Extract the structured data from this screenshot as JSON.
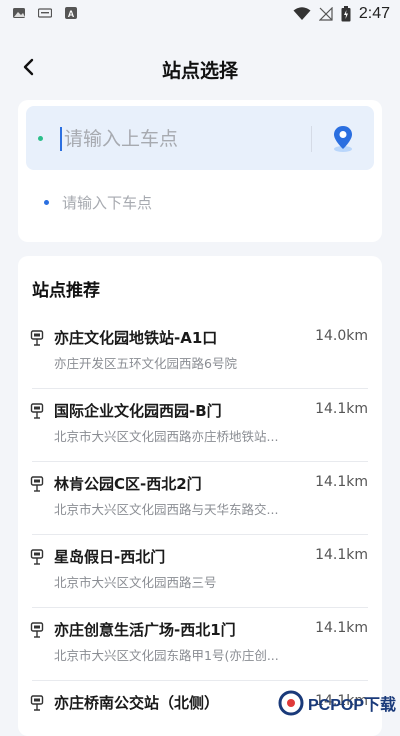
{
  "status_bar": {
    "time": "2:47",
    "icons": [
      "gallery-icon",
      "keyboard-icon",
      "font-icon",
      "wifi-icon",
      "no-signal-icon",
      "battery-charging-icon"
    ]
  },
  "header": {
    "title": "站点选择",
    "back_icon": "chevron-left-icon"
  },
  "route": {
    "pickup_placeholder": "请输入上车点",
    "dropoff_placeholder": "请输入下车点",
    "pickup_dot_color": "#2bbf8a",
    "dropoff_dot_color": "#2b6fe0",
    "locate_icon": "map-pin-icon"
  },
  "recommend": {
    "title": "站点推荐",
    "items": [
      {
        "name": "亦庄文化园地铁站-A1口",
        "distance": "14.0km",
        "address": "亦庄开发区五环文化园西路6号院"
      },
      {
        "name": "国际企业文化园西园-B门",
        "distance": "14.1km",
        "address": "北京市大兴区文化园西路亦庄桥地铁站..."
      },
      {
        "name": "林肯公园C区-西北2门",
        "distance": "14.1km",
        "address": "北京市大兴区文化园西路与天华东路交..."
      },
      {
        "name": "星岛假日-西北门",
        "distance": "14.1km",
        "address": "北京市大兴区文化园西路三号"
      },
      {
        "name": "亦庄创意生活广场-西北1门",
        "distance": "14.1km",
        "address": "北京市大兴区文化园东路甲1号(亦庄创..."
      },
      {
        "name": "亦庄桥南公交站（北侧）",
        "distance": "14.1km",
        "address": ""
      }
    ]
  },
  "watermark": {
    "text": "PCPOP下载"
  },
  "colors": {
    "accent": "#2b6fe0",
    "background": "#f3f5f9"
  }
}
